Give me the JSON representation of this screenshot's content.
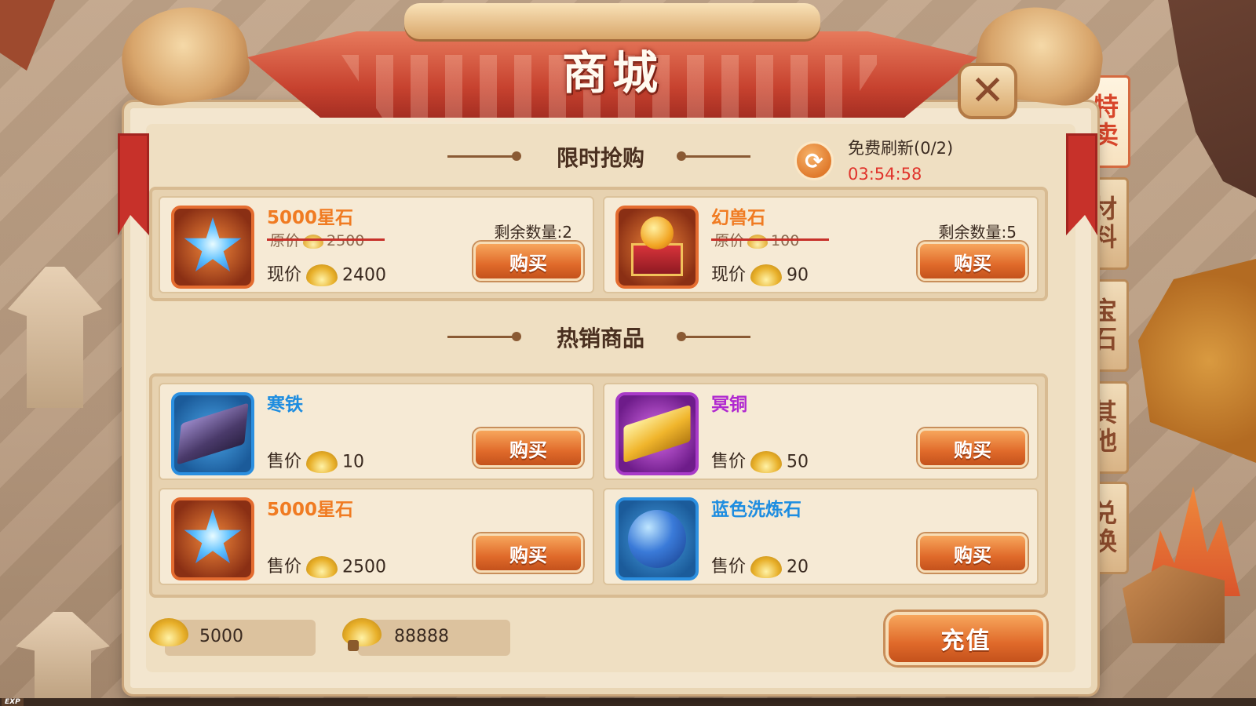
{
  "title": "商城",
  "close_symbol": "✕",
  "tabs": [
    {
      "label": "特卖",
      "active": true
    },
    {
      "label": "材料",
      "active": false
    },
    {
      "label": "宝石",
      "active": false
    },
    {
      "label": "其他",
      "active": false
    },
    {
      "label": "兑换",
      "active": false
    }
  ],
  "flash_sale": {
    "heading": "限时抢购",
    "refresh_label": "免费刷新(0/2)",
    "timer": "03:54:58",
    "items": [
      {
        "name": "5000星石",
        "orig_label": "原价",
        "orig_price": "2500",
        "cur_label": "现价",
        "cur_price": "2400",
        "remain": "剩余数量:2",
        "buy": "购买",
        "icon": "star-stone-icon"
      },
      {
        "name": "幻兽石",
        "orig_label": "原价",
        "orig_price": "100",
        "cur_label": "现价",
        "cur_price": "90",
        "remain": "剩余数量:5",
        "buy": "购买",
        "icon": "beast-stone-icon"
      }
    ]
  },
  "hot": {
    "heading": "热销商品",
    "items": [
      {
        "name": "寒铁",
        "price_label": "售价",
        "price": "10",
        "buy": "购买",
        "icon": "cold-iron-icon"
      },
      {
        "name": "冥铜",
        "price_label": "售价",
        "price": "50",
        "buy": "购买",
        "icon": "nether-copper-icon"
      },
      {
        "name": "5000星石",
        "price_label": "售价",
        "price": "2500",
        "buy": "购买",
        "icon": "star-stone-icon"
      },
      {
        "name": "蓝色洗炼石",
        "price_label": "售价",
        "price": "20",
        "buy": "购买",
        "icon": "blue-refine-stone-icon"
      }
    ]
  },
  "currency": {
    "gold": "5000",
    "bound_gold": "88888",
    "recharge": "充值"
  },
  "exp_label": "EXP",
  "colors": {
    "accent": "#e06a2a",
    "timer": "#e0332b",
    "name_orange": "#f07b22",
    "name_blue": "#1e8de0",
    "name_purple": "#b028d0"
  }
}
